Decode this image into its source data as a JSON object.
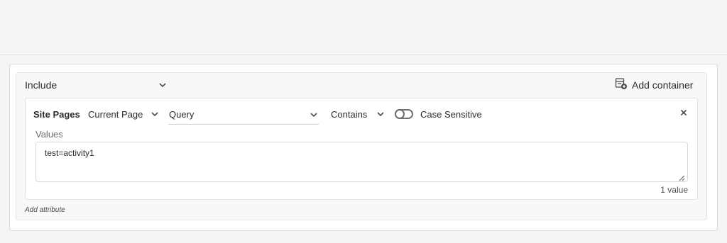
{
  "include": {
    "label": "Include",
    "icon": "chevron-down-icon"
  },
  "add_container": {
    "label": "Add container",
    "icon": "add-container-icon"
  },
  "rule": {
    "dimension": "Site Pages",
    "page_selector": "Current Page",
    "field": "Query",
    "operator": "Contains",
    "case_sensitive_label": "Case Sensitive",
    "case_sensitive_on": false,
    "close_icon": "close-icon"
  },
  "values": {
    "label": "Values",
    "text": "test=activity1",
    "count_label": "1 value"
  },
  "add_attribute": {
    "label": "Add attribute"
  },
  "colors": {
    "background": "#f5f5f5",
    "panel": "#ffffff",
    "border": "#dcdcdc",
    "text": "#2c2c2c",
    "muted": "#6e6e6e"
  }
}
